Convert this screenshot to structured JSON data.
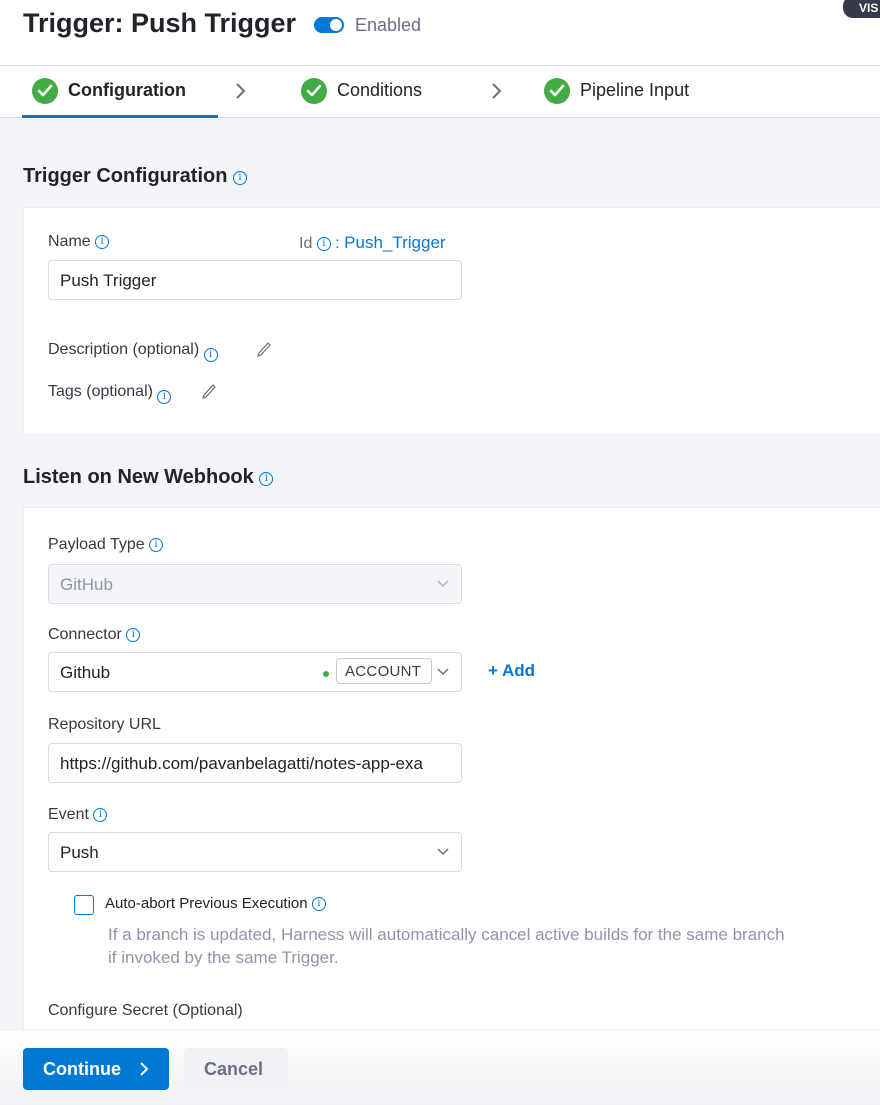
{
  "header": {
    "title": "Trigger: Push Trigger",
    "enabled_label": "Enabled",
    "badge": "VIS"
  },
  "tabs": [
    {
      "label": "Configuration",
      "status": "complete",
      "active": true
    },
    {
      "label": "Conditions",
      "status": "complete",
      "active": false
    },
    {
      "label": "Pipeline Input",
      "status": "complete",
      "active": false
    }
  ],
  "trigger_configuration": {
    "heading": "Trigger Configuration",
    "name_label": "Name",
    "name_value": "Push Trigger",
    "id_label": "Id",
    "id_value": "Push_Trigger",
    "description_label": "Description (optional)",
    "tags_label": "Tags (optional)"
  },
  "webhook": {
    "heading": "Listen on New Webhook",
    "payload_type_label": "Payload Type",
    "payload_type_value": "GitHub",
    "connector_label": "Connector",
    "connector_value": "Github",
    "connector_scope": "ACCOUNT",
    "add_label": "+ Add",
    "repo_url_label": "Repository URL",
    "repo_url_value": "https://github.com/pavanbelagatti/notes-app-exa",
    "event_label": "Event",
    "event_value": "Push",
    "auto_abort_label": "Auto-abort Previous Execution",
    "auto_abort_help_1": "If a branch is updated, Harness will automatically cancel active builds for the same branch",
    "auto_abort_help_2": "if invoked by the same Trigger.",
    "configure_secret_label": "Configure Secret (Optional)"
  },
  "footer": {
    "continue_label": "Continue",
    "cancel_label": "Cancel"
  },
  "colors": {
    "accent": "#0278d5",
    "success": "#42ab45",
    "text": "#22222a",
    "muted": "#6b6d85"
  },
  "icons": [
    "check-circle-icon",
    "chevron-right-icon",
    "info-icon",
    "pencil-icon",
    "chevron-down-icon",
    "status-dot-icon"
  ]
}
